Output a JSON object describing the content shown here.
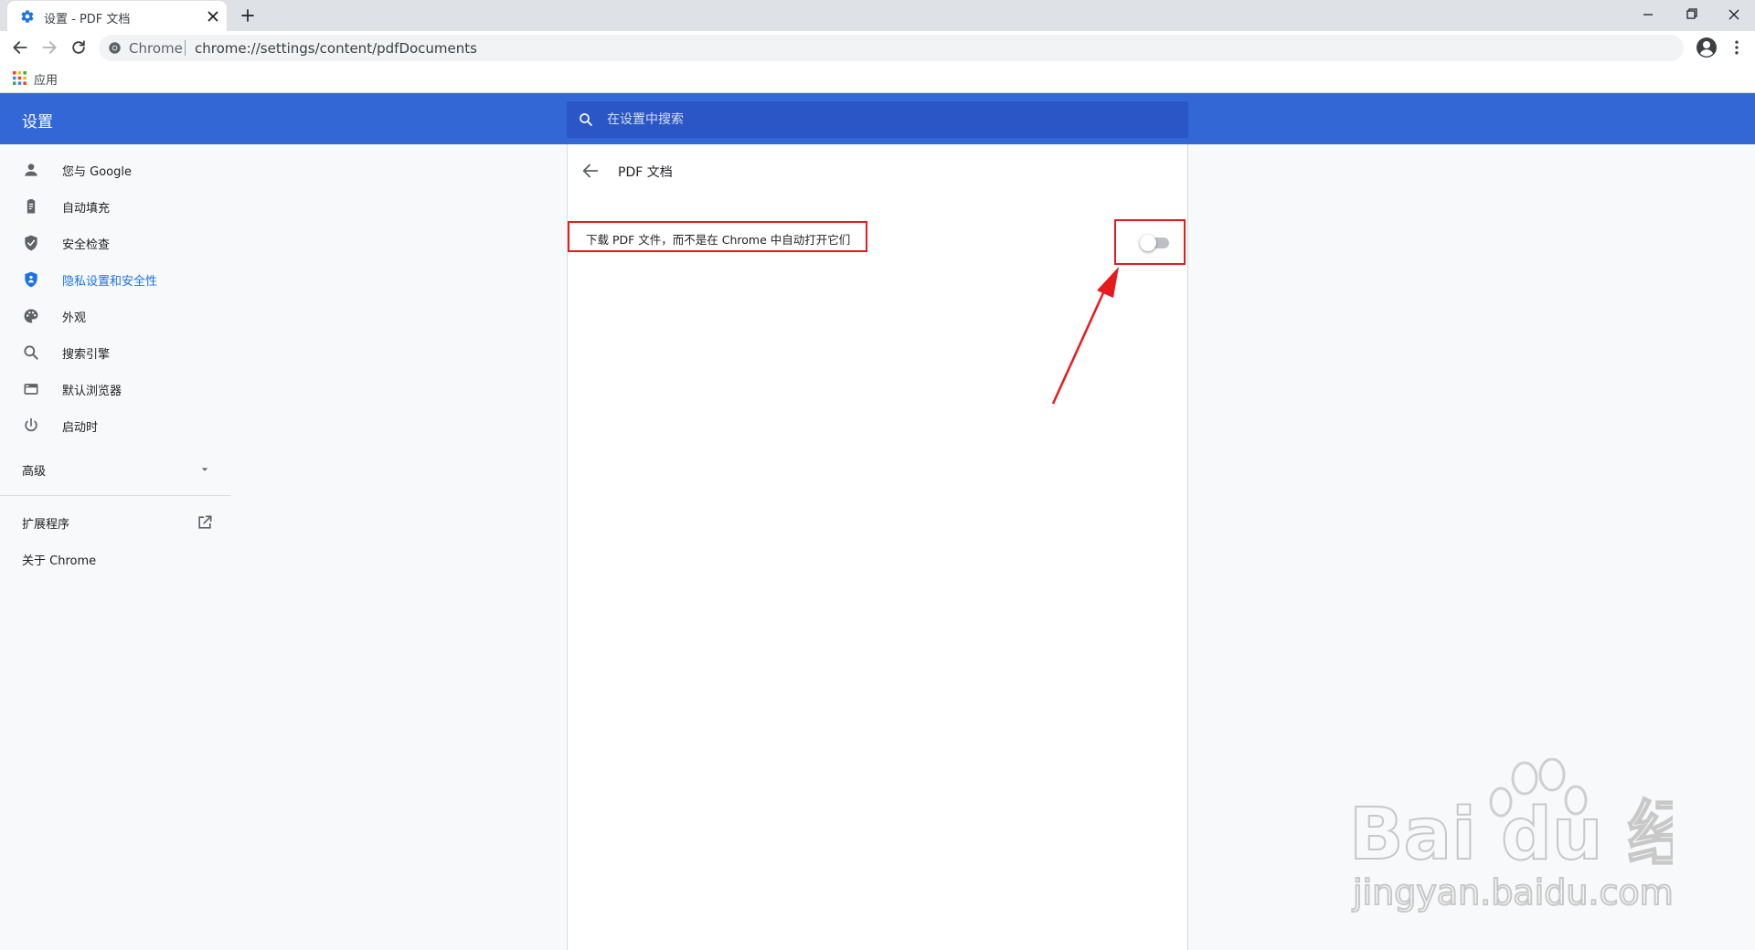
{
  "browser": {
    "tab_title": "设置 - PDF 文档",
    "omnibox_chip": "Chrome",
    "url": "chrome://settings/content/pdfDocuments",
    "bookmark_apps_label": "应用"
  },
  "settings": {
    "header_title": "设置",
    "search_placeholder": "在设置中搜索",
    "nav": [
      {
        "label": "您与 Google",
        "icon": "person-icon"
      },
      {
        "label": "自动填充",
        "icon": "clipboard-icon"
      },
      {
        "label": "安全检查",
        "icon": "shield-check-icon"
      },
      {
        "label": "隐私设置和安全性",
        "icon": "shield-privacy-icon",
        "active": true
      },
      {
        "label": "外观",
        "icon": "palette-icon"
      },
      {
        "label": "搜索引擎",
        "icon": "search-icon"
      },
      {
        "label": "默认浏览器",
        "icon": "browser-window-icon"
      },
      {
        "label": "启动时",
        "icon": "power-icon"
      }
    ],
    "advanced_label": "高级",
    "extensions_label": "扩展程序",
    "about_label": "关于 Chrome"
  },
  "page": {
    "title": "PDF 文档",
    "row_label": "下载 PDF 文件，而不是在 Chrome 中自动打开它们",
    "toggle_on": false
  },
  "watermark": {
    "brand": "Bai du 经验",
    "url": "jingyan.baidu.com"
  },
  "colors": {
    "accent": "#3367d6",
    "active_text": "#1a73e8",
    "annotation": "#e8191d"
  }
}
